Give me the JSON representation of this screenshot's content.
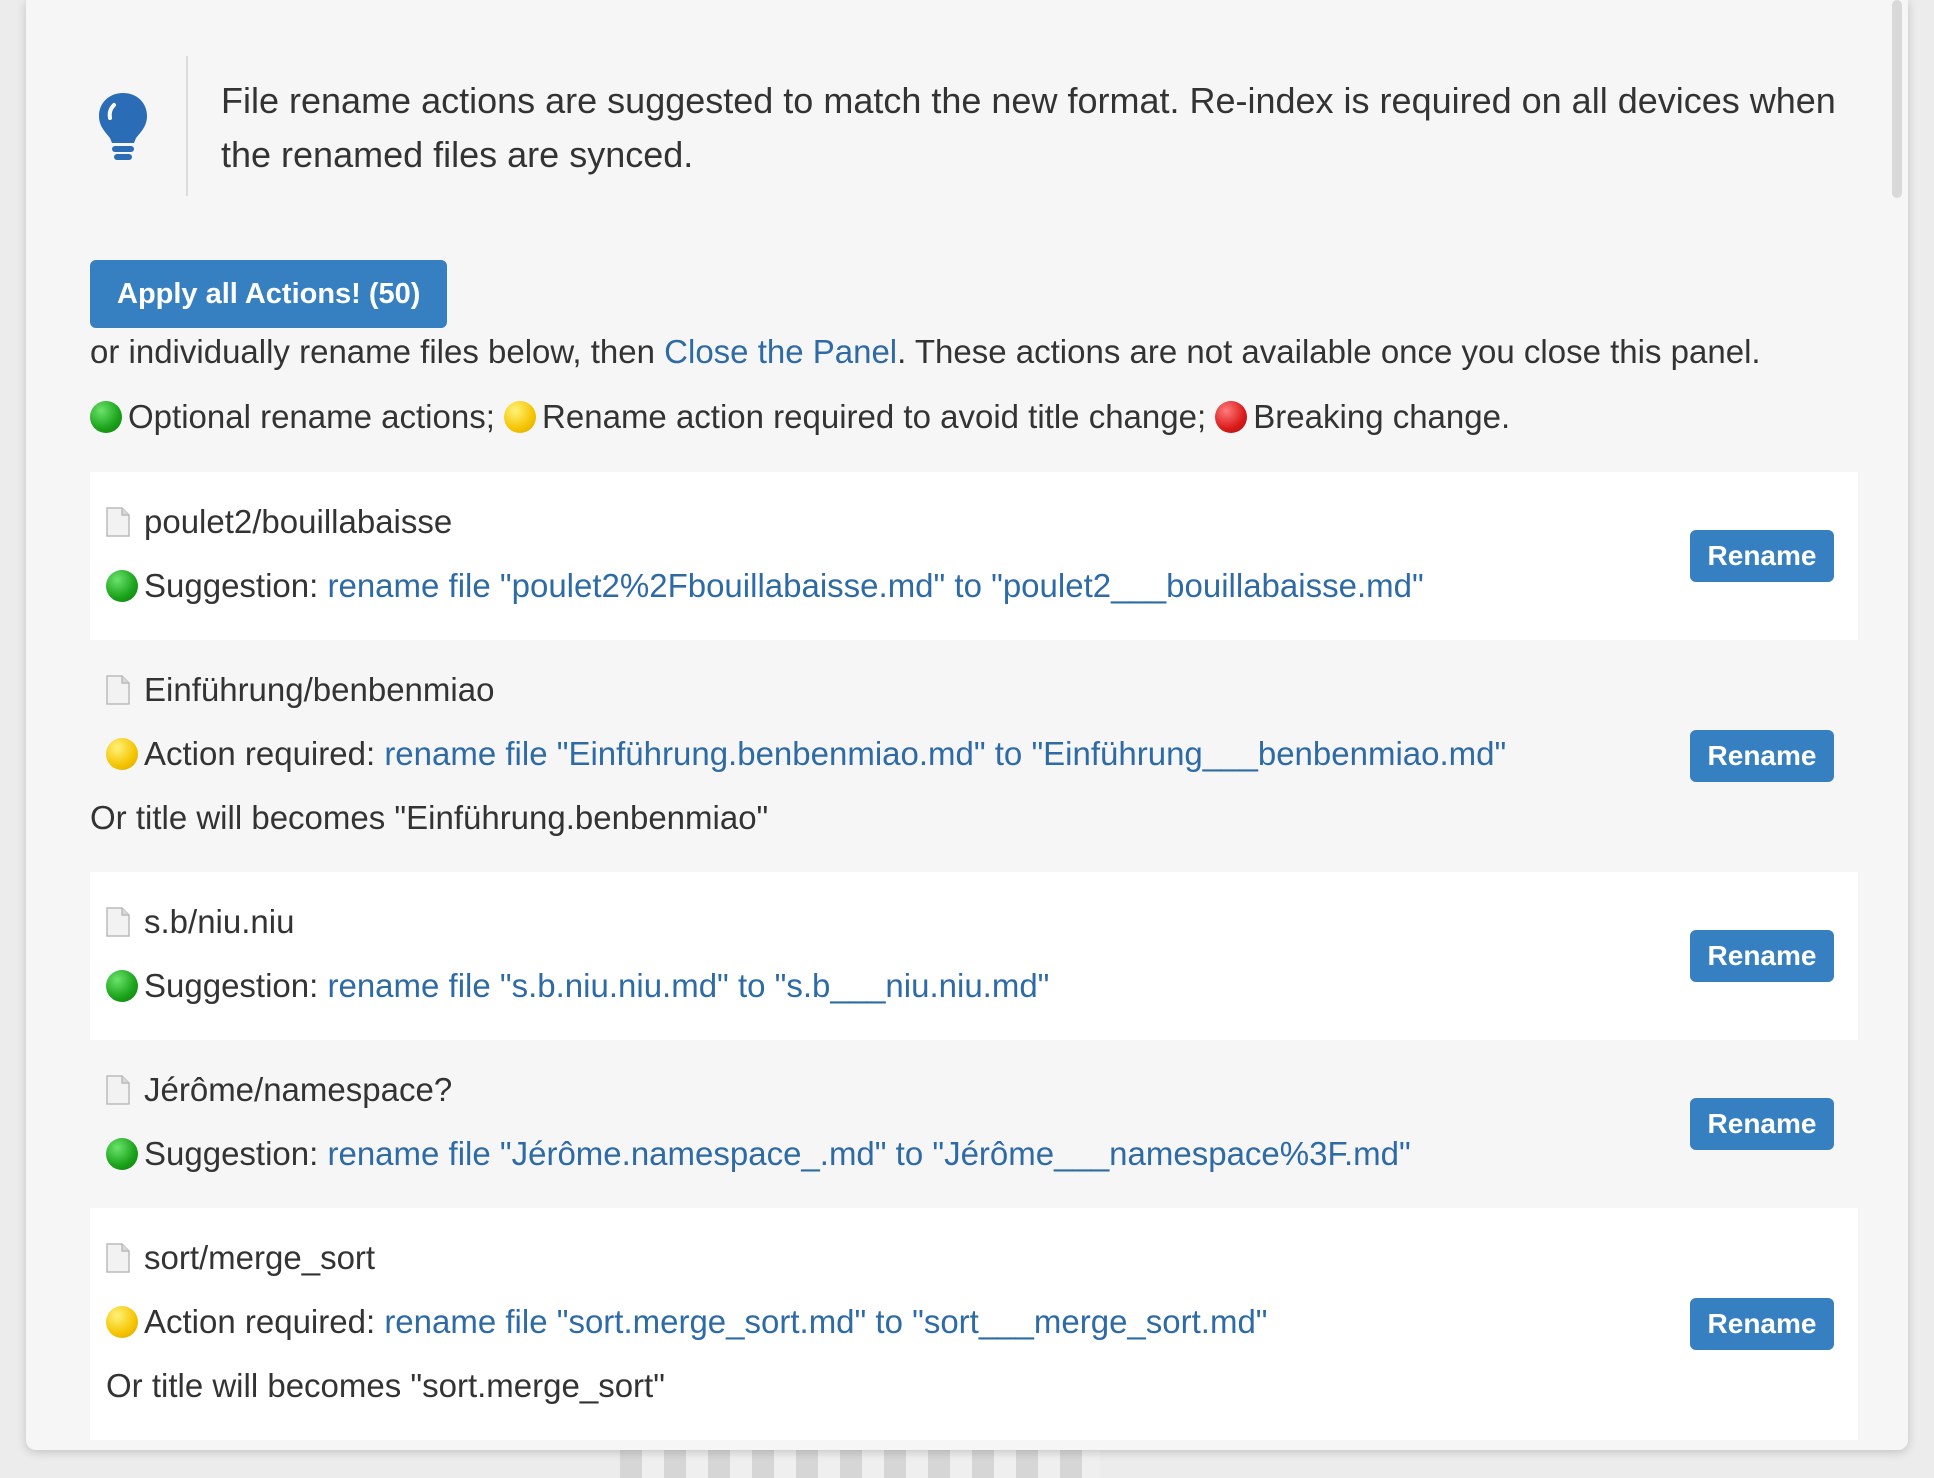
{
  "callout": {
    "icon": "lightbulb-icon",
    "text": "File rename actions are suggested to match the new format. Re-index is required on all devices when the renamed files are synced."
  },
  "actions": {
    "apply_all_label": "Apply all Actions! (50)",
    "info_prefix": "or individually rename files below, then ",
    "close_link": "Close the Panel",
    "info_suffix": ". These actions are not available once you close this panel."
  },
  "legend": {
    "optional": "Optional rename actions;",
    "required": "Rename action required to avoid title change;",
    "breaking": "Breaking change."
  },
  "items": [
    {
      "title": "poulet2/bouillabaisse",
      "level": "green",
      "label": "Suggestion:",
      "action": "rename file \"poulet2%2Fbouillabaisse.md\" to \"poulet2___bouillabaisse.md\"",
      "note": "",
      "button": "Rename"
    },
    {
      "title": "Einführung/benbenmiao",
      "level": "yellow",
      "label": "Action required:",
      "action": "rename file \"Einführung.benbenmiao.md\" to \"Einführung___benbenmiao.md\"",
      "note": "Or title will becomes \"Einführung.benbenmiao\"",
      "button": "Rename"
    },
    {
      "title": "s.b/niu.niu",
      "level": "green",
      "label": "Suggestion:",
      "action": "rename file \"s.b.niu.niu.md\" to \"s.b___niu.niu.md\"",
      "note": "",
      "button": "Rename"
    },
    {
      "title": "Jérôme/namespace?",
      "level": "green",
      "label": "Suggestion:",
      "action": "rename file \"Jérôme.namespace_.md\" to \"Jérôme___namespace%3F.md\"",
      "note": "",
      "button": "Rename"
    },
    {
      "title": "sort/merge_sort",
      "level": "yellow",
      "label": "Action required:",
      "action": "rename file \"sort.merge_sort.md\" to \"sort___merge_sort.md\"",
      "note": "Or title will becomes \"sort.merge_sort\"",
      "button": "Rename"
    }
  ]
}
